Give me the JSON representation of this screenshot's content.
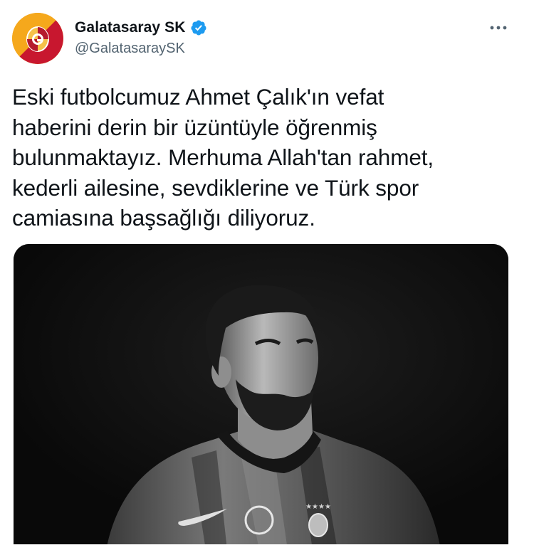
{
  "header": {
    "display_name": "Galatasaray SK",
    "handle": "@GalatasaraySK",
    "verified": true,
    "more_icon": "more-horizontal-icon"
  },
  "tweet": {
    "text_lines": [
      "Eski futbolcumuz Ahmet Çalık'ın vefat",
      "haberini derin bir üzüntüyle öğrenmiş",
      "bulunmaktayız. Merhuma Allah'tan rahmet,",
      "kederli ailesine, sevdiklerine ve Türk spor",
      "camiasına başsağlığı diliyoruz."
    ]
  },
  "media": {
    "description_icon": "player-photo-image",
    "style": "black-and-white"
  },
  "colors": {
    "text_primary": "#0f1419",
    "text_secondary": "#536471",
    "verified_blue": "#1d9bf0",
    "club_yellow": "#fdb913",
    "club_red": "#a90432"
  }
}
